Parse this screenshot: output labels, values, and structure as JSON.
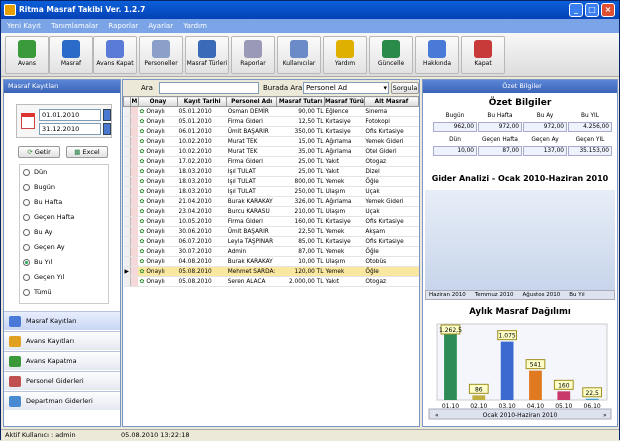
{
  "window": {
    "title": "Ritma Masraf Takibi Ver. 1.2.7"
  },
  "menu": [
    "Yeni Kayıt",
    "Tanımlamalar",
    "Raporlar",
    "Ayarlar",
    "Yardım"
  ],
  "toolbar": [
    {
      "label": "Avans",
      "icon": "avans-icon",
      "color": "#3a9a3a"
    },
    {
      "label": "Masraf",
      "icon": "masraf-icon",
      "color": "#2a6ac8"
    },
    {
      "label": "Avans Kapat",
      "icon": "avans-kapat-icon",
      "color": "#5a7ad8"
    },
    {
      "label": "Personeller",
      "icon": "personeller-icon",
      "color": "#8aa0c8"
    },
    {
      "label": "Masraf Türleri",
      "icon": "masraf-turleri-icon",
      "color": "#3a6ab8"
    },
    {
      "label": "Raporlar",
      "icon": "raporlar-icon",
      "color": "#9a9ab8"
    },
    {
      "label": "Kullanıcılar",
      "icon": "kullanicilar-icon",
      "color": "#6a8ac8"
    },
    {
      "label": "Yardım",
      "icon": "yardim-icon",
      "color": "#e0b000"
    },
    {
      "label": "Güncelle",
      "icon": "guncelle-icon",
      "color": "#2a8a4a"
    },
    {
      "label": "Hakkında",
      "icon": "hakkinda-icon",
      "color": "#4a7ad8"
    },
    {
      "label": "Kapat",
      "icon": "kapat-icon",
      "color": "#c83a3a"
    }
  ],
  "left": {
    "header": "Masraf Kayıtları",
    "date_from": "01.01.2010",
    "date_to": "31.12.2010",
    "getir": "Getir",
    "excel": "Excel",
    "periods": [
      "Dün",
      "Bugün",
      "Bu Hafta",
      "Geçen Hafta",
      "Bu Ay",
      "Geçen Ay",
      "Bu Yıl",
      "Geçen Yıl",
      "Tümü"
    ],
    "selected_period": "Bu Yıl",
    "nav": [
      "Masraf Kayıtları",
      "Avans Kayıtları",
      "Avans Kapatma",
      "Personel Giderleri",
      "Departman Giderleri"
    ]
  },
  "search": {
    "ara_label": "Ara",
    "burada_label": "Burada Ara",
    "field": "Personel Ad",
    "button": "Sorgula"
  },
  "table": {
    "columns": [
      "M",
      "Onay",
      "Kayıt Tarihi",
      "Personel Adı",
      "Masraf Tutarı",
      "Masraf Türü",
      "Alt Masraf"
    ],
    "rows": [
      [
        "Onaylı",
        "05.01.2010",
        "Osman DEMİR",
        "90,00 TL",
        "Eğlence",
        "Sinema"
      ],
      [
        "Onaylı",
        "05.01.2010",
        "Firma Gideri",
        "12,50 TL",
        "Kırtasiye",
        "Fotokopi"
      ],
      [
        "Onaylı",
        "06.01.2010",
        "Ümit BAŞARIR",
        "350,00 TL",
        "Kırtasiye",
        "Ofis Kırtasiye"
      ],
      [
        "Onaylı",
        "10.02.2010",
        "Murat TEK",
        "15,00 TL",
        "Ağırlama",
        "Yemek Gideri"
      ],
      [
        "Onaylı",
        "10.02.2010",
        "Murat TEK",
        "35,00 TL",
        "Ağırlama",
        "Otel Gideri"
      ],
      [
        "Onaylı",
        "17.02.2010",
        "Firma Gideri",
        "25,00 TL",
        "Yakıt",
        "Otogaz"
      ],
      [
        "Onaylı",
        "18.03.2010",
        "Işıl TULAT",
        "25,00 TL",
        "Yakıt",
        "Dizel"
      ],
      [
        "Onaylı",
        "18.03.2010",
        "Işıl TULAT",
        "800,00 TL",
        "Yemek",
        "Öğle"
      ],
      [
        "Onaylı",
        "18.03.2010",
        "Işıl TULAT",
        "250,00 TL",
        "Ulaşım",
        "Uçak"
      ],
      [
        "Onaylı",
        "21.04.2010",
        "Burak KARAKAY",
        "326,00 TL",
        "Ağırlama",
        "Yemek Gideri"
      ],
      [
        "Onaylı",
        "23.04.2010",
        "Burcu KARASU",
        "210,00 TL",
        "Ulaşım",
        "Uçak"
      ],
      [
        "Onaylı",
        "10.05.2010",
        "Firma Gideri",
        "160,00 TL",
        "Kırtasiye",
        "Ofis Kırtasiye"
      ],
      [
        "Onaylı",
        "30.06.2010",
        "Ümit BAŞARIR",
        "22,50 TL",
        "Yemek",
        "Akşam"
      ],
      [
        "Onaylı",
        "06.07.2010",
        "Leyla TAŞPINAR",
        "85,00 TL",
        "Kırtasiye",
        "Ofis Kırtasiye"
      ],
      [
        "Onaylı",
        "30.07.2010",
        "Admin",
        "87,00 TL",
        "Yemek",
        "Öğle"
      ],
      [
        "Onaylı",
        "04.08.2010",
        "Burak KARAKAY",
        "10,00 TL",
        "Ulaşım",
        "Otobüs"
      ],
      [
        "Onaylı",
        "05.08.2010",
        "Mehmet SARDA:",
        "120,00 TL",
        "Yemek",
        "Öğle"
      ],
      [
        "Onaylı",
        "05.08.2010",
        "Seren ALACA",
        "2.000,00 TL",
        "Yakıt",
        "Otogaz"
      ]
    ],
    "selected_row": 16
  },
  "right": {
    "header": "Özet Bilgiler",
    "title": "Özet Bilgiler",
    "labels_top": [
      "Bugün",
      "Bu Hafta",
      "Bu Ay",
      "Bu YIL"
    ],
    "values_top": [
      "962,00",
      "972,00",
      "972,00",
      "4.256,00"
    ],
    "labels_bottom": [
      "Dün",
      "Geçen Hafta",
      "Geçen Ay",
      "Geçen YIL"
    ],
    "values_bottom": [
      "10,00",
      "87,00",
      "137,00",
      "35.153,00"
    ],
    "ga_title": "Gider Analizi - Ocak 2010-Haziran 2010",
    "tabs": [
      "Haziran 2010",
      "Temmuz 2010",
      "Ağustos 2010",
      "Bu Yıl"
    ]
  },
  "chart_data": {
    "type": "bar",
    "title": "Aylık Masraf Dağılımı",
    "categories": [
      "01.10",
      "02.10",
      "03.10",
      "04.10",
      "05.10",
      "06.10"
    ],
    "values": [
      1262.5,
      86,
      1075,
      541,
      160,
      22.5
    ],
    "value_labels": [
      "1.262,5",
      "86",
      "1.075",
      "541",
      "160",
      "22,5"
    ],
    "colors": [
      "#2e8b57",
      "#c0b040",
      "#3a6ad0",
      "#e07a20",
      "#c83a6a",
      "#40a0c8"
    ],
    "ylim": [
      0,
      1400
    ],
    "nav_label": "Ocak 2010-Haziran 2010"
  },
  "status": {
    "user": "Aktif Kullanıcı : admin",
    "datetime": "05.08.2010 13:22:18"
  }
}
